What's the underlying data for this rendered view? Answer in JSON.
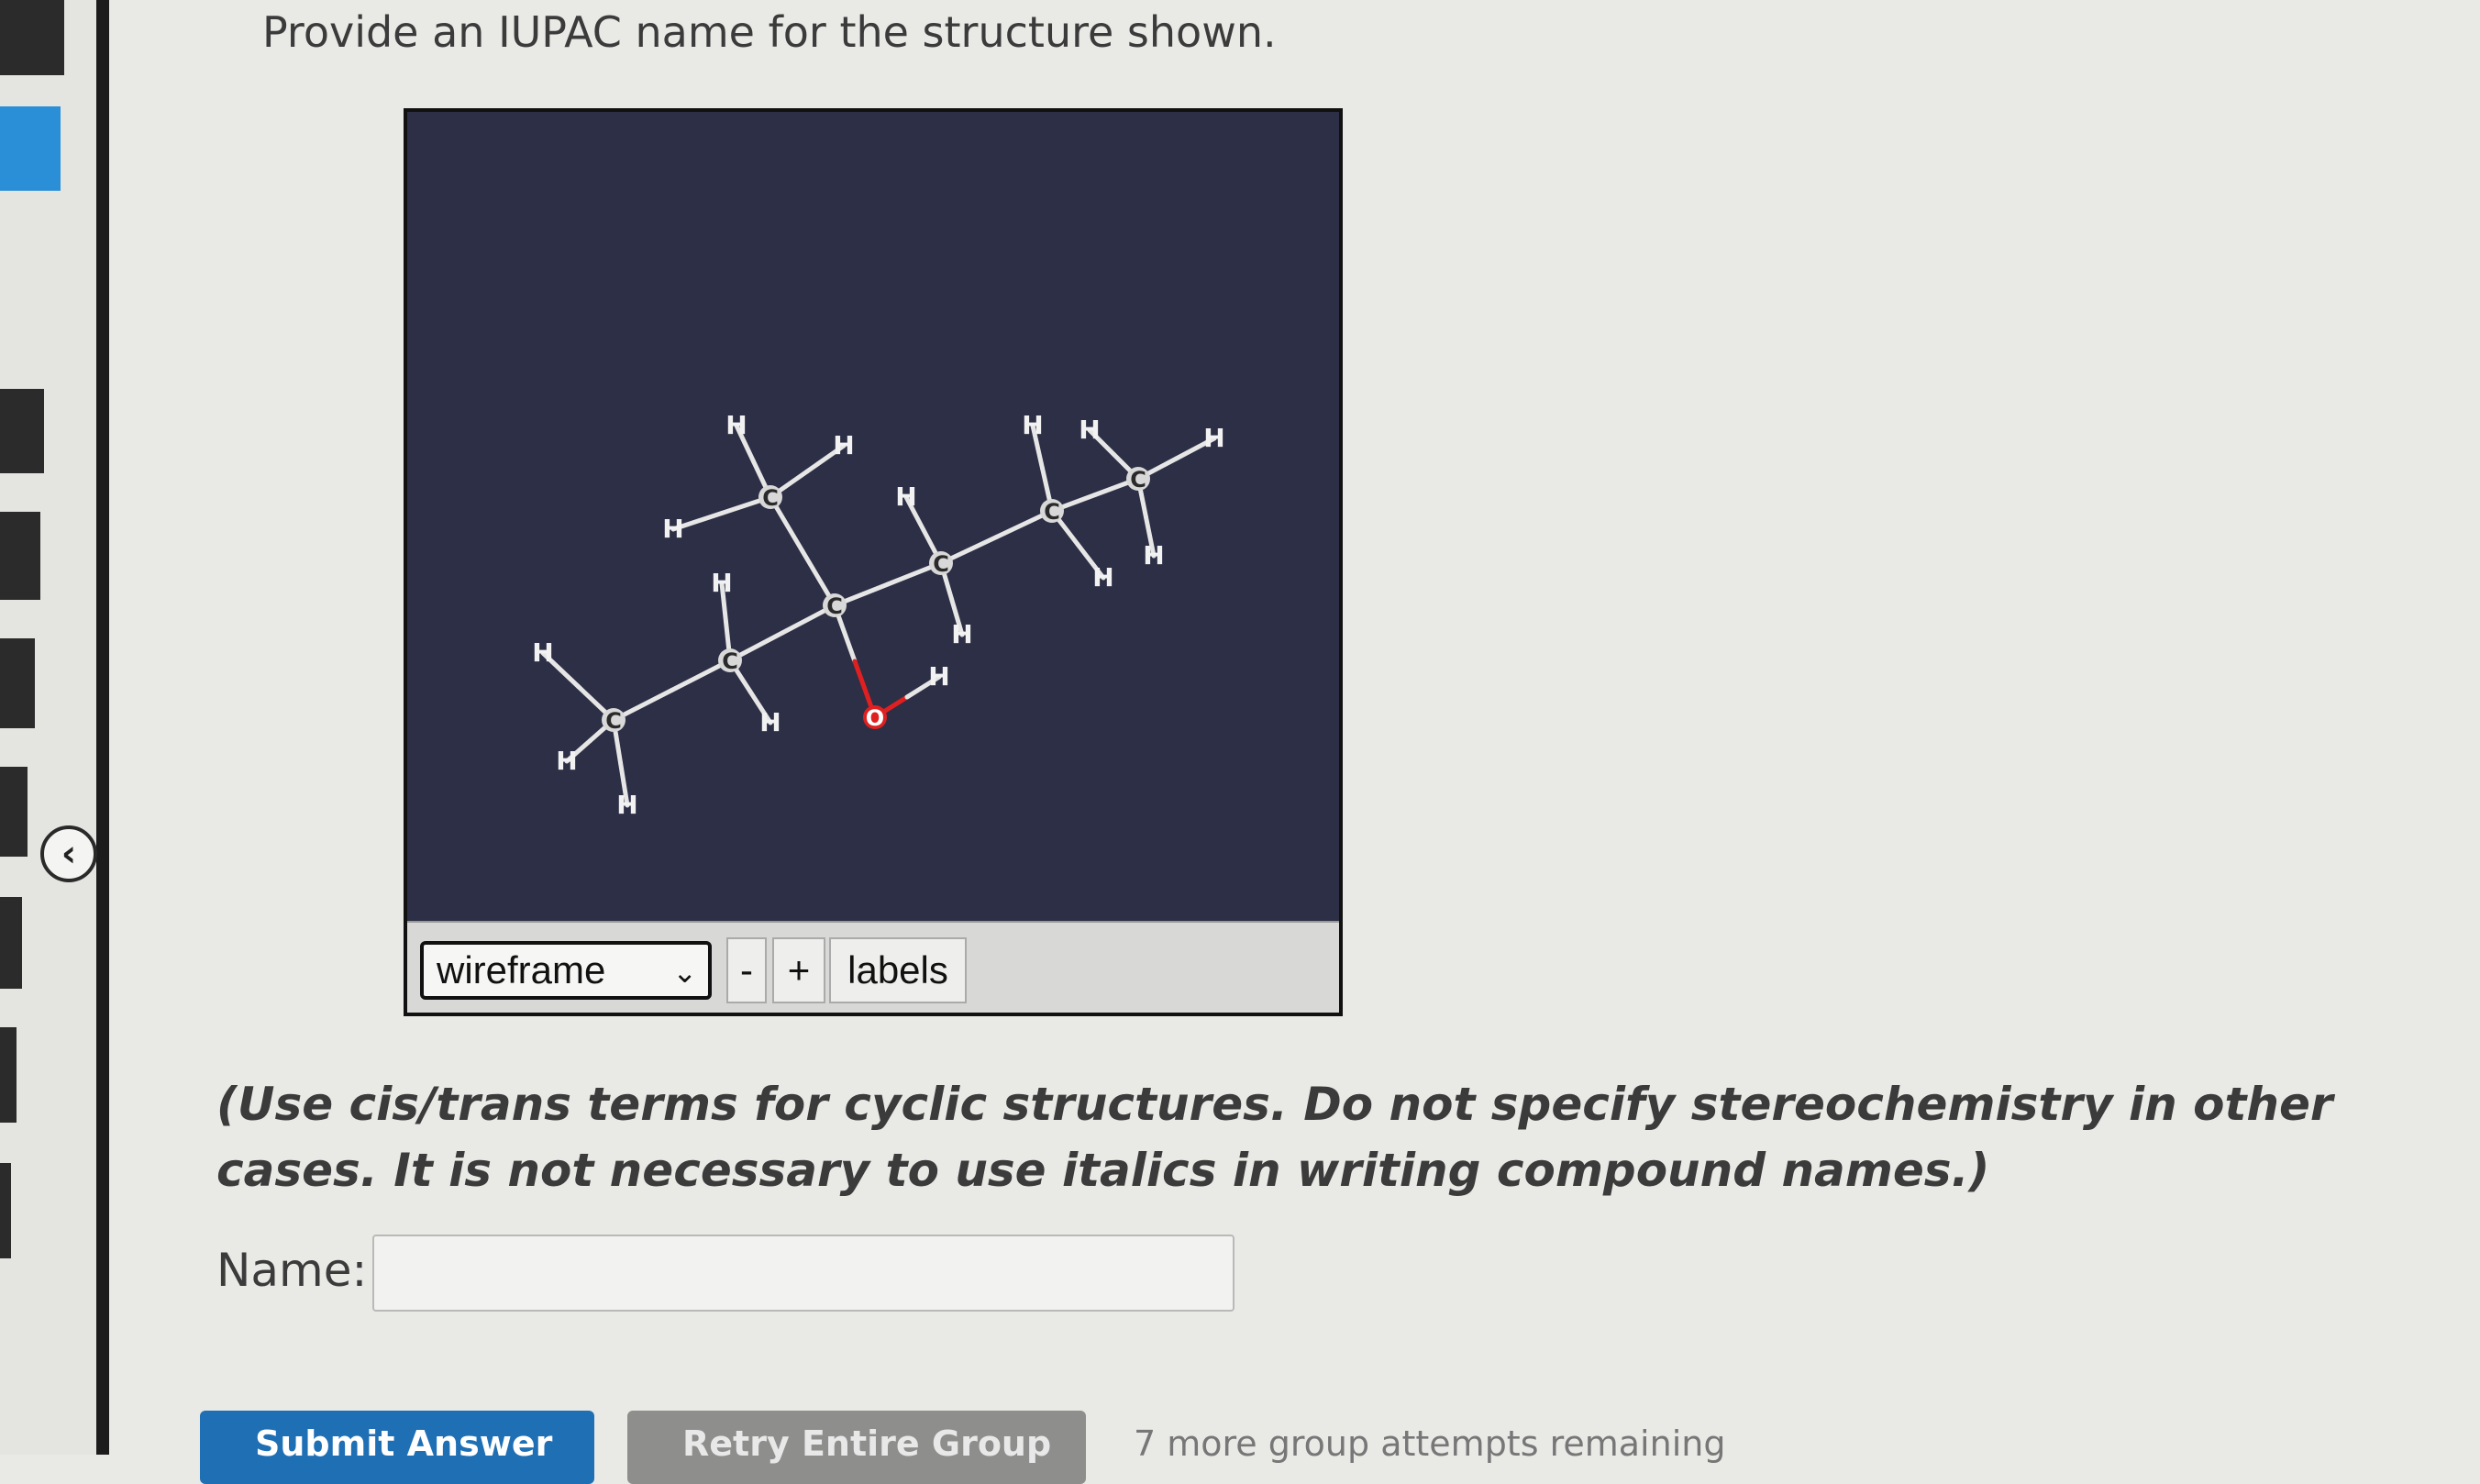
{
  "question": {
    "prompt": "Provide an IUPAC name for the structure shown."
  },
  "viewer": {
    "style_options": [
      "wireframe"
    ],
    "style_selected": "wireframe",
    "zoom_out_label": "-",
    "zoom_in_label": "+",
    "labels_button": "labels",
    "colors": {
      "background": "#2c2f45",
      "bond": "#e6e6e6",
      "oxygen": "#e02020"
    },
    "atoms": [
      {
        "id": "c1",
        "el": "C"
      },
      {
        "id": "c2",
        "el": "C"
      },
      {
        "id": "c3",
        "el": "C"
      },
      {
        "id": "c4",
        "el": "C"
      },
      {
        "id": "c5",
        "el": "C"
      },
      {
        "id": "c6",
        "el": "C"
      },
      {
        "id": "c7",
        "el": "C"
      },
      {
        "id": "o1",
        "el": "O"
      },
      {
        "id": "h1",
        "el": "H"
      },
      {
        "id": "h2",
        "el": "H"
      },
      {
        "id": "h3",
        "el": "H"
      },
      {
        "id": "h4",
        "el": "H"
      },
      {
        "id": "h5",
        "el": "H"
      },
      {
        "id": "h6",
        "el": "H"
      },
      {
        "id": "h7",
        "el": "H"
      },
      {
        "id": "h8",
        "el": "H"
      },
      {
        "id": "h9",
        "el": "H"
      },
      {
        "id": "h10",
        "el": "H"
      },
      {
        "id": "h11",
        "el": "H"
      },
      {
        "id": "h12",
        "el": "H"
      },
      {
        "id": "h13",
        "el": "H"
      },
      {
        "id": "h14",
        "el": "H"
      },
      {
        "id": "h15",
        "el": "H"
      },
      {
        "id": "h16",
        "el": "H"
      }
    ]
  },
  "instructions": "(Use cis/trans terms for cyclic structures. Do not specify stereochemistry in other cases. It is not necessary to use italics in writing compound names.)",
  "answer": {
    "name_label": "Name:",
    "name_value": ""
  },
  "actions": {
    "submit_label": "Submit Answer",
    "retry_label": "Retry Entire Group",
    "attempts_text": "7 more group attempts remaining"
  }
}
